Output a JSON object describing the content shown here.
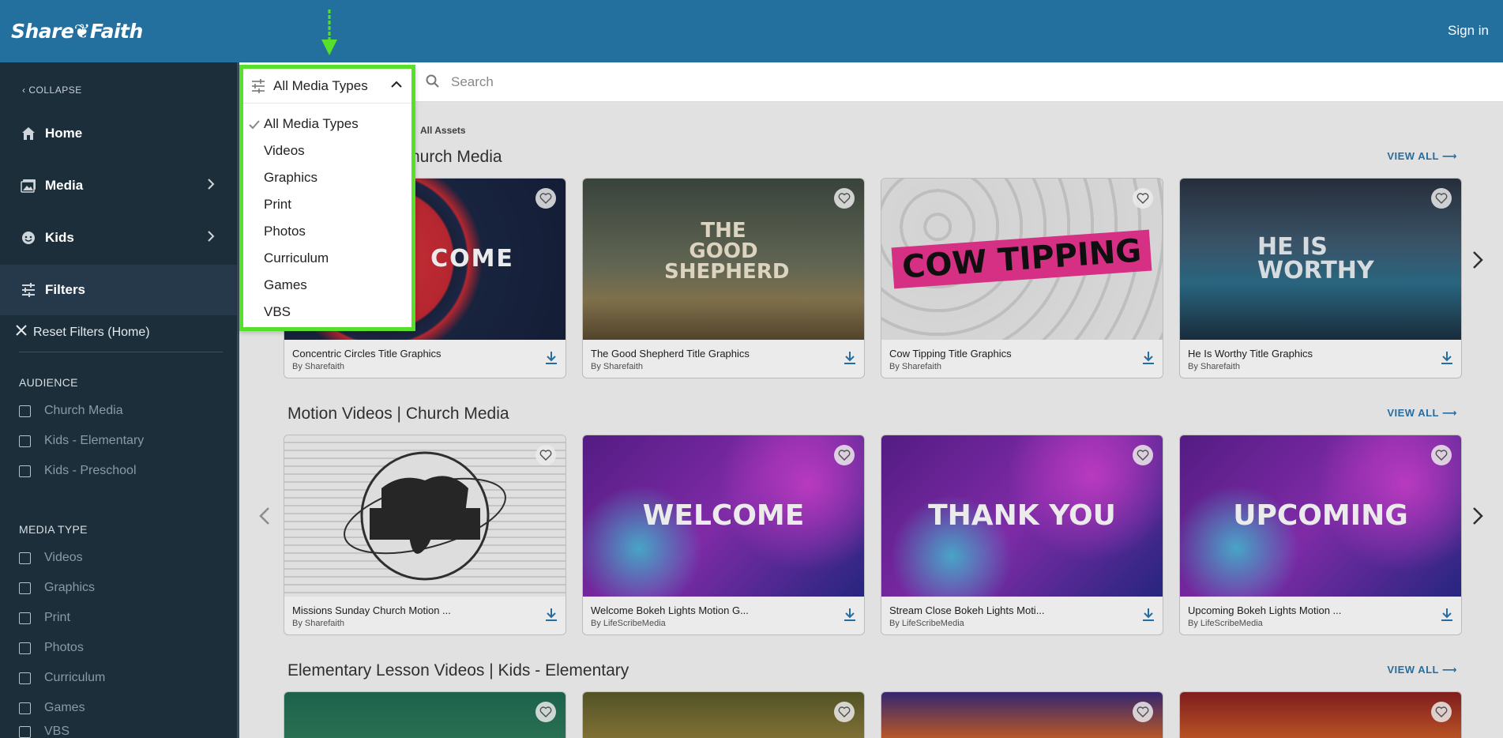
{
  "header": {
    "logo": "Share❦Faith",
    "sign_in": "Sign in"
  },
  "sidebar": {
    "collapse": "COLLAPSE",
    "nav": [
      {
        "label": "Home"
      },
      {
        "label": "Media"
      },
      {
        "label": "Kids"
      },
      {
        "label": "Filters"
      }
    ],
    "reset": "Reset Filters (Home)",
    "audience_heading": "AUDIENCE",
    "audience": [
      "Church Media",
      "Kids - Elementary",
      "Kids - Preschool"
    ],
    "media_type_heading": "MEDIA TYPE",
    "media_types": [
      "Videos",
      "Graphics",
      "Print",
      "Photos",
      "Curriculum",
      "Games",
      "VBS"
    ]
  },
  "search": {
    "placeholder": "Search"
  },
  "dropdown": {
    "selected": "All Media Types",
    "options": [
      "All Media Types",
      "Videos",
      "Graphics",
      "Print",
      "Photos",
      "Curriculum",
      "Games",
      "VBS"
    ]
  },
  "breadcrumb": "All Assets",
  "rows": [
    {
      "title": "hurch Media",
      "view_all": "VIEW ALL",
      "cards": [
        {
          "title": "Concentric Circles Title Graphics",
          "by": "By Sharefaith",
          "thumb_text": "COME"
        },
        {
          "title": "The Good Shepherd Title Graphics",
          "by": "By Sharefaith",
          "thumb_text": "THE GOOD SHEPHERD"
        },
        {
          "title": "Cow Tipping Title Graphics",
          "by": "By Sharefaith",
          "thumb_text": "COW TIPPING"
        },
        {
          "title": "He Is Worthy Title Graphics",
          "by": "By Sharefaith",
          "thumb_text": "HE IS WORTHY"
        }
      ]
    },
    {
      "title": "Motion Videos | Church Media",
      "view_all": "VIEW ALL",
      "cards": [
        {
          "title": "Missions Sunday Church Motion ...",
          "by": "By Sharefaith",
          "thumb_text": ""
        },
        {
          "title": "Welcome Bokeh Lights Motion G...",
          "by": "By LifeScribeMedia",
          "thumb_text": "WELCOME"
        },
        {
          "title": "Stream Close Bokeh Lights Moti...",
          "by": "By LifeScribeMedia",
          "thumb_text": "THANK YOU"
        },
        {
          "title": "Upcoming Bokeh Lights Motion ...",
          "by": "By LifeScribeMedia",
          "thumb_text": "UPCOMING"
        }
      ]
    },
    {
      "title": "Elementary Lesson Videos | Kids - Elementary",
      "view_all": "VIEW ALL"
    }
  ],
  "colors": {
    "header": "#236f9e",
    "sidebar": "#1c2e3a",
    "accent": "#2a77ad",
    "highlight": "#57e02a"
  }
}
